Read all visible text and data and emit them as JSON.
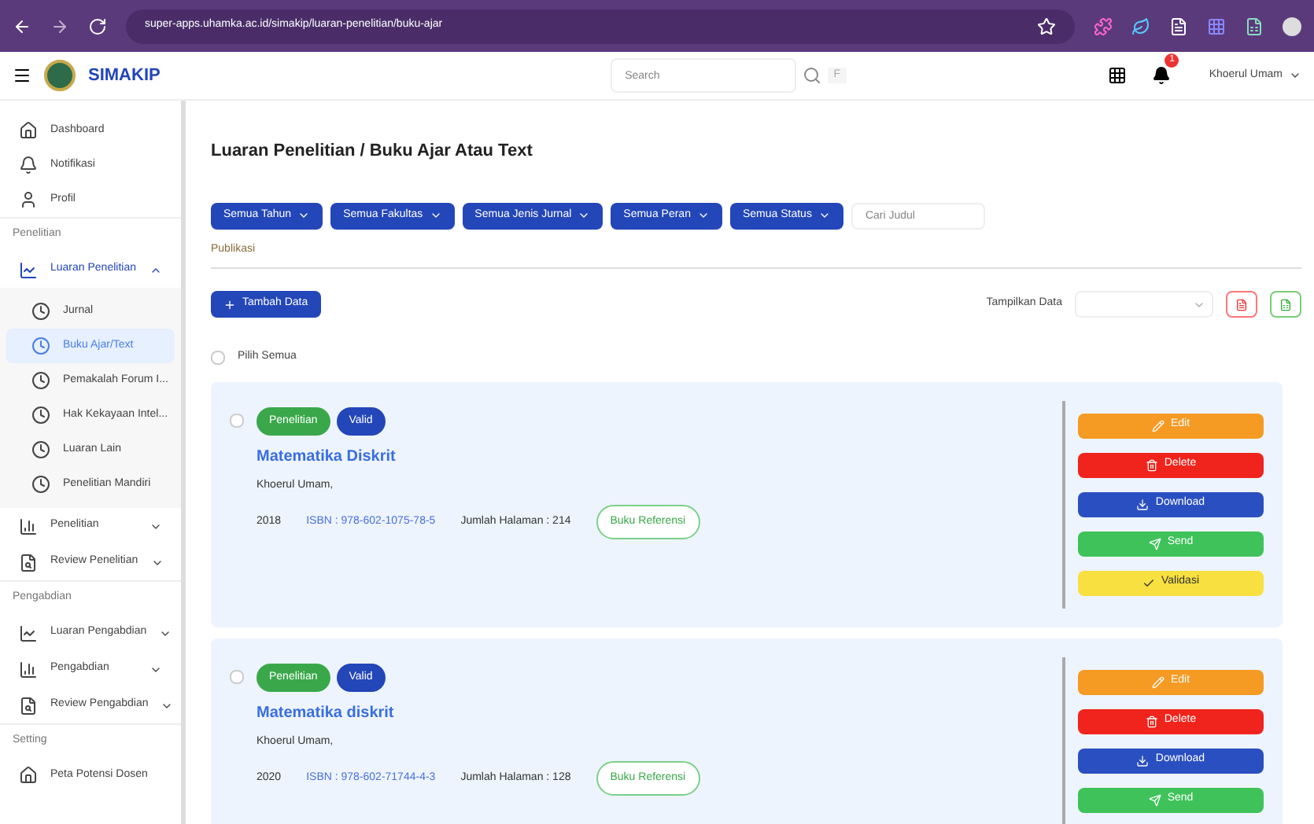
{
  "browser": {
    "url": "super-apps.uhamka.ac.id/simakip/luaran-penelitian/buku-ajar"
  },
  "header": {
    "brand": "SIMAKIP",
    "search": {
      "placeholder": "Search"
    },
    "shortcut": "F",
    "notification_count": "1",
    "user": "Khoerul Umam"
  },
  "sidebar": [
    {
      "kind": "item",
      "label": "Dashboard"
    },
    {
      "kind": "item",
      "label": "Notifikasi"
    },
    {
      "kind": "item",
      "label": "Profil"
    },
    {
      "kind": "section",
      "label": "Penelitian"
    },
    {
      "kind": "group",
      "label": "Luaran Penelitian",
      "expanded": true,
      "children": [
        {
          "label": "Jurnal",
          "selected": false
        },
        {
          "label": "Buku Ajar/Text",
          "selected": true
        },
        {
          "label": "Pemakalah Forum I...",
          "selected": false
        },
        {
          "label": "Hak Kekayaan Intel...",
          "selected": false
        },
        {
          "label": "Luaran Lain",
          "selected": false
        },
        {
          "label": "Penelitian Mandiri",
          "selected": false
        }
      ]
    },
    {
      "kind": "group",
      "label": "Penelitian",
      "expanded": false
    },
    {
      "kind": "group",
      "label": "Review Penelitian",
      "expanded": false
    },
    {
      "kind": "section",
      "label": "Pengabdian"
    },
    {
      "kind": "group",
      "label": "Luaran Pengabdian",
      "expanded": false
    },
    {
      "kind": "group",
      "label": "Pengabdian",
      "expanded": false
    },
    {
      "kind": "group",
      "label": "Review Pengabdian",
      "expanded": false
    },
    {
      "kind": "section",
      "label": "Setting"
    },
    {
      "kind": "item",
      "label": "Peta Potensi Dosen"
    }
  ],
  "page": {
    "title": "Luaran Penelitian / Buku Ajar Atau Text",
    "filters": [
      "Semua Tahun",
      "Semua Fakultas",
      "Semua Jenis Jurnal",
      "Semua Peran",
      "Semua Status"
    ],
    "search": {
      "placeholder": "Cari Judul"
    },
    "section_label": "Publikasi",
    "add_button": "Tambah Data",
    "show_label": "Tampilkan Data",
    "select_all": {
      "label": "Pilih Semua",
      "checked": false
    }
  },
  "cards": [
    {
      "checked": false,
      "tags": [
        {
          "label": "Penelitian",
          "color": "#3aa84a"
        },
        {
          "label": "Valid",
          "color": "#2346b8"
        }
      ],
      "title": "Matematika Diskrit",
      "author": "Khoerul Umam,",
      "year": "2018",
      "isbn": "ISBN : 978-602-1075-78-5",
      "pages": "Jumlah Halaman : 214",
      "category": "Buku Referensi",
      "actions": [
        {
          "kind": "edit",
          "label": "Edit"
        },
        {
          "kind": "delete",
          "label": "Delete"
        },
        {
          "kind": "download",
          "label": "Download"
        },
        {
          "kind": "send",
          "label": "Send"
        },
        {
          "kind": "validate",
          "label": "Validasi"
        }
      ]
    },
    {
      "checked": false,
      "tags": [
        {
          "label": "Penelitian",
          "color": "#3aa84a"
        },
        {
          "label": "Valid",
          "color": "#2346b8"
        }
      ],
      "title": "Matematika diskrit",
      "author": "Khoerul Umam,",
      "year": "2020",
      "isbn": "ISBN : 978-602-71744-4-3",
      "pages": "Jumlah Halaman : 128",
      "category": "Buku Referensi",
      "actions": [
        {
          "kind": "edit",
          "label": "Edit"
        },
        {
          "kind": "delete",
          "label": "Delete"
        },
        {
          "kind": "download",
          "label": "Download"
        },
        {
          "kind": "send",
          "label": "Send"
        }
      ]
    }
  ]
}
